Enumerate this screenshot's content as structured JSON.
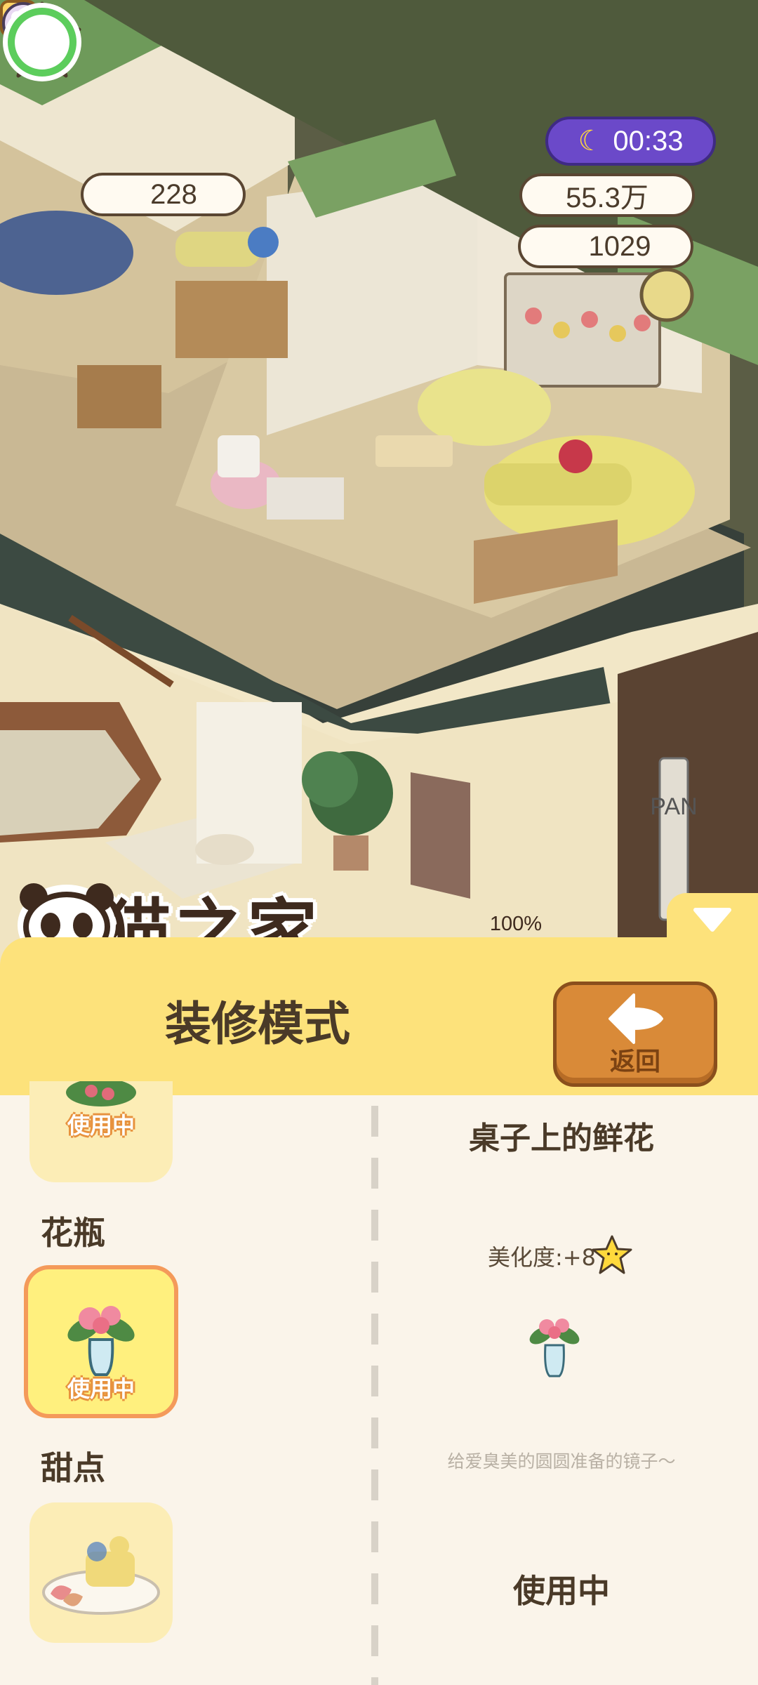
{
  "hud": {
    "star_count": "228",
    "timer": "00:33",
    "bamboo": "55.3万",
    "pearls": "1029"
  },
  "banner": {
    "game_title": "熊猫之家",
    "progress": "100%",
    "progress_fraction": 1.0,
    "sign_text": "PAN"
  },
  "header": {
    "mode_title": "装修模式",
    "back_label": "返回"
  },
  "categories": {
    "top_in_use": "使用中",
    "vase_label": "花瓶",
    "vase_in_use": "使用中",
    "dessert_label": "甜点"
  },
  "detail": {
    "name": "桌子上的鲜花",
    "beauty": "美化度:+8",
    "description": "给爱臭美的圆圆准备的镜子～",
    "status": "使用中"
  },
  "colors": {
    "panel_yellow": "#fde27b",
    "back_orange": "#d98a38",
    "timer_purple": "#6b49c9",
    "selected_border": "#f49a5a",
    "progress_green": "#5ccd5c"
  }
}
